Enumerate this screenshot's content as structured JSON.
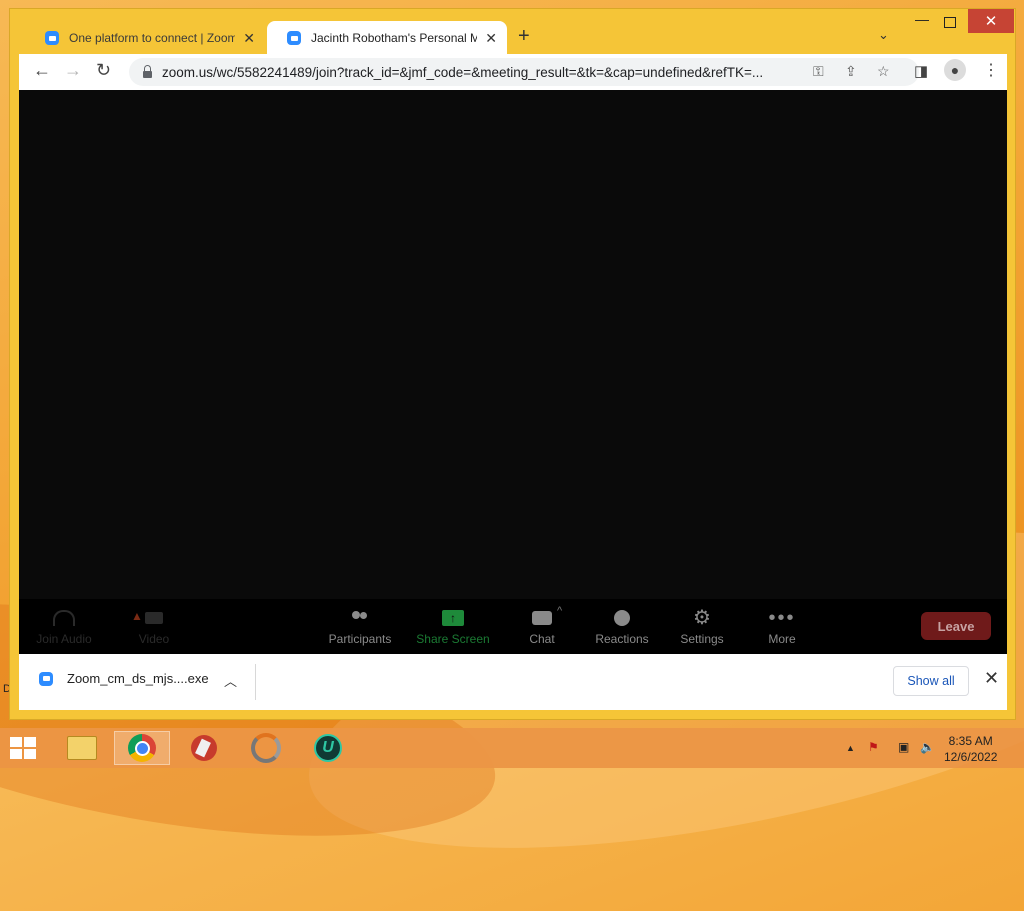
{
  "browser": {
    "tabs": [
      {
        "title": "One platform to connect | Zoom",
        "active": false
      },
      {
        "title": "Jacinth Robotham's Personal Me",
        "active": true
      }
    ],
    "address": "zoom.us/wc/5582241489/join?track_id=&jmf_code=&meeting_result=&tk=&cap=undefined&refTK=..."
  },
  "meeting": {
    "toolbar": [
      {
        "label": "Join Audio",
        "icon": "headphone-icon",
        "enabled": false
      },
      {
        "label": "Video",
        "icon": "camera-icon",
        "enabled": false
      },
      {
        "label": "Participants",
        "icon": "participants-icon",
        "enabled": true
      },
      {
        "label": "Share Screen",
        "icon": "share-screen-icon",
        "enabled": true
      },
      {
        "label": "Chat",
        "icon": "chat-icon",
        "enabled": true
      },
      {
        "label": "Reactions",
        "icon": "reactions-icon",
        "enabled": true
      },
      {
        "label": "Settings",
        "icon": "gear-icon",
        "enabled": true
      },
      {
        "label": "More",
        "icon": "more-dots-icon",
        "enabled": true
      }
    ],
    "leave_label": "Leave",
    "share_color": "#1e8a3a",
    "leave_color": "#6f1a1a"
  },
  "downloads": {
    "file_name": "Zoom_cm_ds_mjs....exe",
    "show_all_label": "Show all"
  },
  "taskbar": {
    "apps": [
      "file-explorer-icon",
      "chrome-icon",
      "ccleaner-icon",
      "app-ring-icon",
      "u-app-icon"
    ],
    "time": "8:35 AM",
    "date": "12/6/2022"
  },
  "desktop": {
    "edge_letters": [
      "D"
    ]
  }
}
